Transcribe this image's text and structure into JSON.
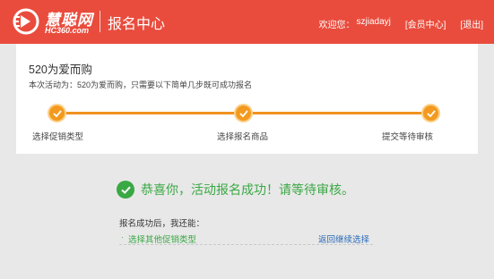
{
  "header": {
    "logo_name": "慧聪网",
    "logo_sub": "HC360.com",
    "title": "报名中心",
    "welcome": "欢迎您：",
    "username": "szjiadayj",
    "member_center": "[会员中心]",
    "logout": "[退出]"
  },
  "activity": {
    "title": "520为爱而购",
    "description": "本次活动为：520为爱而购，只需要以下简单几步既可成功报名"
  },
  "steps": [
    {
      "label": "选择促销类型",
      "status": "done"
    },
    {
      "label": "选择报名商品",
      "status": "done"
    },
    {
      "label": "提交等待审核",
      "status": "done"
    }
  ],
  "result": {
    "message": "恭喜你，活动报名成功！请等待审核。",
    "next_title": "报名成功后，我还能：",
    "bullet": "·",
    "other_promo_link": "选择其他促销类型",
    "back_link": "返回继续选择"
  },
  "colors": {
    "header_bg": "#e94c3d",
    "step_orange": "#f39a1e",
    "success_green": "#3aa844",
    "link_blue": "#2a6bb8"
  }
}
